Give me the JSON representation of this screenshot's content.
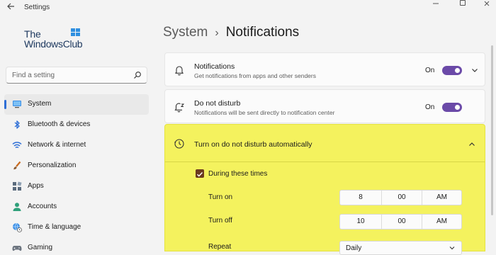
{
  "window": {
    "title": "Settings"
  },
  "logo": {
    "line1": "The",
    "line2": "WindowsClub"
  },
  "search": {
    "placeholder": "Find a setting"
  },
  "sidebar": {
    "items": [
      {
        "label": "System",
        "icon": "monitor-icon",
        "active": true
      },
      {
        "label": "Bluetooth & devices",
        "icon": "bluetooth-icon"
      },
      {
        "label": "Network & internet",
        "icon": "wifi-icon"
      },
      {
        "label": "Personalization",
        "icon": "brush-icon"
      },
      {
        "label": "Apps",
        "icon": "apps-icon"
      },
      {
        "label": "Accounts",
        "icon": "person-icon"
      },
      {
        "label": "Time & language",
        "icon": "globe-clock-icon"
      },
      {
        "label": "Gaming",
        "icon": "gamepad-icon"
      }
    ]
  },
  "breadcrumb": {
    "parent": "System",
    "separator": "›",
    "current": "Notifications"
  },
  "notifications_card": {
    "title": "Notifications",
    "subtitle": "Get notifications from apps and other senders",
    "state": "On",
    "icon": "bell-icon"
  },
  "dnd_card": {
    "title": "Do not disturb",
    "subtitle": "Notifications will be sent directly to notification center",
    "state": "On",
    "icon": "bell-snooze-icon"
  },
  "auto_dnd": {
    "title": "Turn on do not disturb automatically",
    "icon": "clock-icon",
    "during_times_label": "During these times",
    "turn_on": {
      "label": "Turn on",
      "hour": "8",
      "minute": "00",
      "period": "AM"
    },
    "turn_off": {
      "label": "Turn off",
      "hour": "10",
      "minute": "00",
      "period": "AM"
    },
    "repeat": {
      "label": "Repeat",
      "value": "Daily"
    }
  },
  "colors": {
    "accent_toggle": "#6b4aa8",
    "highlight": "#f4f25e",
    "checkbox": "#6b3a1f",
    "active_indicator": "#2f6fd6"
  }
}
